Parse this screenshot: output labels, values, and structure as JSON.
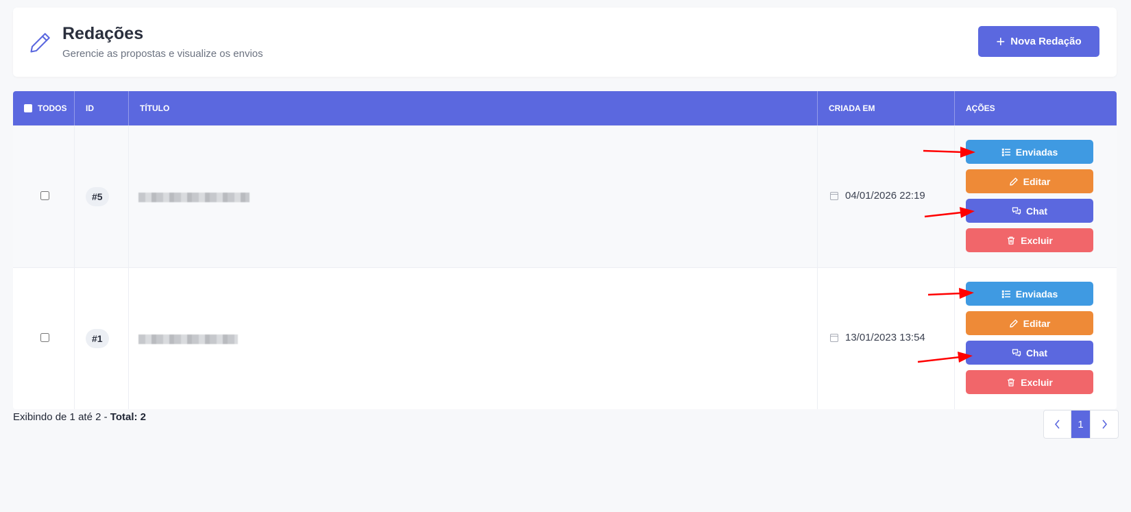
{
  "header": {
    "title": "Redações",
    "subtitle": "Gerencie as propostas e visualize os envios",
    "new_button_label": "Nova Redação"
  },
  "table": {
    "columns": [
      "TODOS",
      "ID",
      "TÍTULO",
      "CRIADA EM",
      "AÇÕES"
    ],
    "rows": [
      {
        "id": "#5",
        "date": "04/01/2026 22:19"
      },
      {
        "id": "#1",
        "date": "13/01/2023 13:54"
      }
    ],
    "actions": {
      "enviadas": "Enviadas",
      "editar": "Editar",
      "chat": "Chat",
      "excluir": "Excluir"
    }
  },
  "footer": {
    "showing": "Exibindo de 1 até 2 - ",
    "total": "Total: 2"
  },
  "pagination": {
    "current_page": "1"
  },
  "colors": {
    "primary": "#5b68df",
    "enviadas": "#3f9ae2",
    "editar": "#ee8a37",
    "excluir": "#f1666a",
    "annotation_arrow": "#ff0000"
  }
}
